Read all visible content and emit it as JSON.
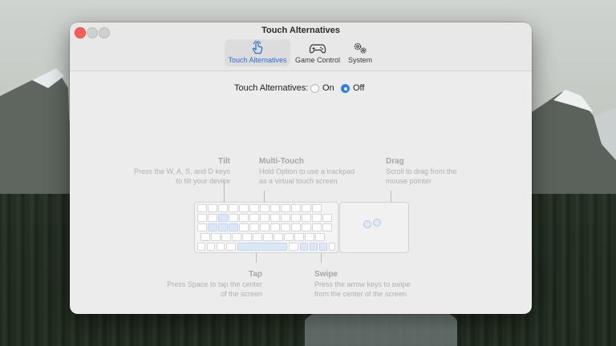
{
  "window": {
    "title": "Touch Alternatives"
  },
  "tabs": [
    {
      "label": "Touch Alternatives",
      "icon": "hand-pointer-icon",
      "active": true
    },
    {
      "label": "Game Control",
      "icon": "gamepad-icon",
      "active": false
    },
    {
      "label": "System",
      "icon": "gears-icon",
      "active": false
    }
  ],
  "toggle": {
    "label": "Touch Alternatives:",
    "options": [
      {
        "label": "On",
        "selected": false
      },
      {
        "label": "Off",
        "selected": true
      }
    ]
  },
  "hints": {
    "tilt": {
      "title": "Tilt",
      "text1": "Press the W, A, S, and D keys",
      "text2": "to tilt your device"
    },
    "multitouch": {
      "title": "Multi-Touch",
      "text1": "Hold Option to use a trackpad",
      "text2": "as a virtual touch screen"
    },
    "drag": {
      "title": "Drag",
      "text1": "Scroll to drag from the",
      "text2": "mouse pointer"
    },
    "tap": {
      "title": "Tap",
      "text1": "Press Space to tap the center",
      "text2": "of the screen"
    },
    "swipe": {
      "title": "Swipe",
      "text1": "Press the arrow keys to swipe",
      "text2": "from the center of the screen"
    }
  },
  "colors": {
    "accent": "#2f7cf6",
    "highlight": "#dbe6f7",
    "close": "#ff5f57"
  }
}
